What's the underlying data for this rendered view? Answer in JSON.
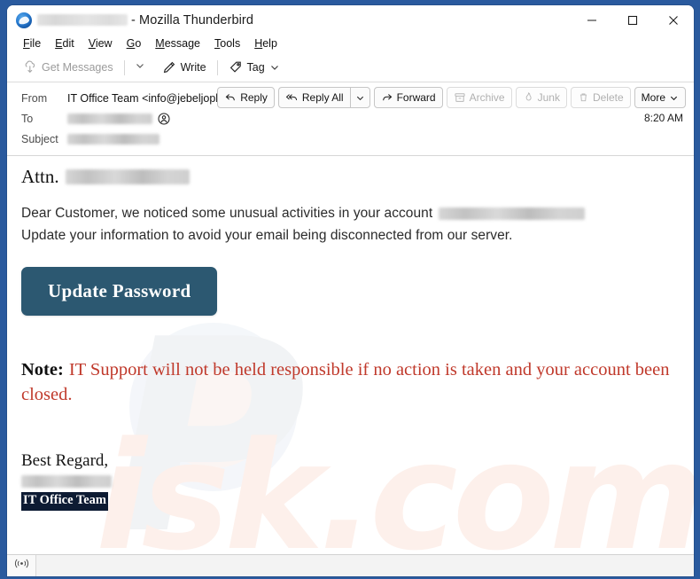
{
  "window": {
    "title_suffix": "- Mozilla Thunderbird",
    "title_redacted": true,
    "logo_icon": "thunderbird-logo-icon",
    "controls": {
      "minimize": "minimize-icon",
      "maximize": "maximize-icon",
      "close": "close-icon"
    }
  },
  "menubar": {
    "items": [
      {
        "label": "File",
        "mnemonic": "F",
        "rest": "ile"
      },
      {
        "label": "Edit",
        "mnemonic": "E",
        "rest": "dit"
      },
      {
        "label": "View",
        "mnemonic": "V",
        "rest": "iew"
      },
      {
        "label": "Go",
        "mnemonic": "G",
        "rest": "o"
      },
      {
        "label": "Message",
        "mnemonic": "M",
        "rest": "essage"
      },
      {
        "label": "Tools",
        "mnemonic": "T",
        "rest": "ools"
      },
      {
        "label": "Help",
        "mnemonic": "H",
        "rest": "elp"
      }
    ]
  },
  "toolbar": {
    "get_messages_label": "Get Messages",
    "get_messages_icon": "cloud-download-icon",
    "get_messages_disabled": true,
    "get_messages_caret_icon": "chevron-down-icon",
    "write_label": "Write",
    "write_icon": "pencil-icon",
    "tag_label": "Tag",
    "tag_icon": "tag-icon",
    "tag_caret_icon": "chevron-down-icon"
  },
  "message_header": {
    "from_label": "From",
    "from_value": "IT Office Team <info@jebeljoplc.shop>",
    "from_contact_icon": "contact-card-icon",
    "to_label": "To",
    "to_value_redacted": true,
    "to_contact_icon": "contact-card-icon",
    "subject_label": "Subject",
    "subject_value_redacted": true,
    "time": "8:20 AM",
    "actions": [
      {
        "label": "Reply",
        "icon": "reply-icon",
        "disabled": false
      },
      {
        "label": "Reply All",
        "icon": "reply-all-icon",
        "disabled": false
      },
      {
        "label": "Forward",
        "icon": "forward-icon",
        "disabled": false
      },
      {
        "label": "Archive",
        "icon": "archive-icon",
        "disabled": true
      },
      {
        "label": "Junk",
        "icon": "flame-icon",
        "disabled": true
      },
      {
        "label": "Delete",
        "icon": "trash-icon",
        "disabled": true
      },
      {
        "label": "More",
        "icon": "chevron-down-icon",
        "disabled": false
      }
    ],
    "reply_all_caret_icon": "chevron-down-icon"
  },
  "body": {
    "attn_label": "Attn.",
    "attn_value_redacted": true,
    "paragraph1_before": "Dear Customer, we noticed some unusual activities in your account",
    "paragraph1_account_redacted": true,
    "paragraph2": "Update your information to avoid your email being disconnected from our server.",
    "cta_label": "Update Password",
    "cta_color": "#2c5871",
    "note_label": "Note:",
    "note_text": "IT Support will not be held responsible if no action is taken and your account been closed.",
    "note_color": "#c0392b",
    "signoff": "Best Regard,",
    "signoff_name_redacted": true,
    "signature_team": "IT Office Team",
    "watermark_p": "P",
    "watermark_isk": "isk.com"
  },
  "statusbar": {
    "connection_icon": "broadcast-icon",
    "text": ""
  }
}
